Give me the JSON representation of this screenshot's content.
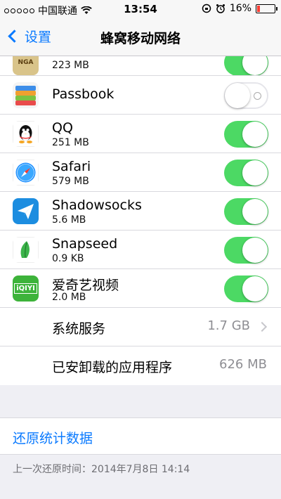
{
  "status_bar": {
    "carrier": "中国联通",
    "time": "13:54",
    "battery": "16%",
    "battery_level": 0.16
  },
  "nav": {
    "back_label": "设置",
    "title": "蜂窝移动网络"
  },
  "apps": [
    {
      "name": "",
      "size": "223 MB",
      "enabled": true,
      "icon": "nga-icon",
      "icon_text": "NGA",
      "icon_color": "#d9c48a"
    },
    {
      "name": "Passbook",
      "size": "",
      "enabled": false,
      "icon": "passbook-icon"
    },
    {
      "name": "QQ",
      "size": "251 MB",
      "enabled": true,
      "icon": "qq-penguin-icon"
    },
    {
      "name": "Safari",
      "size": "579 MB",
      "enabled": true,
      "icon": "safari-compass-icon"
    },
    {
      "name": "Shadowsocks",
      "size": "5.6 MB",
      "enabled": true,
      "icon": "paper-plane-icon"
    },
    {
      "name": "Snapseed",
      "size": "0.9 KB",
      "enabled": true,
      "icon": "snapseed-leaf-icon"
    },
    {
      "name": "爱奇艺视频",
      "size": "2.0 MB",
      "enabled": true,
      "icon": "iqiyi-icon",
      "icon_text": "iQIYI",
      "icon_color": "#3db33a"
    }
  ],
  "system_services": {
    "label": "系统服务",
    "value": "1.7 GB"
  },
  "uninstalled_apps": {
    "label": "已安卸载的应用程序",
    "value": "626 MB"
  },
  "reset": {
    "label": "还原统计数据"
  },
  "last_reset": "上一次还原时间：2014年7月8日 14:14",
  "colors": {
    "accent": "#0a7aff",
    "toggle_on": "#4cd964",
    "battery_low": "#ff3b30"
  }
}
